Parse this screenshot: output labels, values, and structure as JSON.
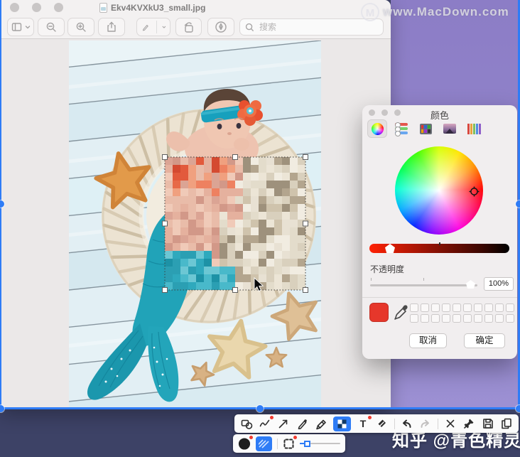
{
  "window": {
    "title": "Ekv4KVXkU3_small.jpg",
    "traffic_lights": [
      "close",
      "minimize",
      "zoom"
    ],
    "toolbar": {
      "icons": [
        "sidebar",
        "zoom-out",
        "zoom-in",
        "share",
        "markup-pen",
        "rotate-left",
        "markup-toggle",
        "search"
      ],
      "search_placeholder": "搜索"
    }
  },
  "watermarks": {
    "macdown_logo": "M",
    "macdown": "www.MacDown.com",
    "zhihu": "知乎 @青色精灵"
  },
  "color_panel": {
    "title": "颜色",
    "tabs": [
      "color-wheel",
      "color-sliders",
      "color-palettes",
      "image-palettes",
      "pencils"
    ],
    "selected_tab": "color-wheel",
    "opacity_label": "不透明度",
    "opacity_value": "100%",
    "cancel_label": "取消",
    "confirm_label": "确定",
    "selected_color": "#e6372b",
    "empty_swatch_count": 20
  },
  "annotation_toolbar": {
    "row1_tools": [
      "shapes",
      "scribble",
      "arrow",
      "pencil",
      "highlighter",
      "mosaic",
      "text",
      "eraser",
      "undo",
      "redo",
      "close",
      "pin",
      "save",
      "copy"
    ],
    "active_tool": "mosaic",
    "badged_tools": [
      "scribble",
      "text",
      "color-swatch",
      "border-style"
    ],
    "row2_tools": [
      "color-black",
      "fill-style",
      "border-style",
      "line-width-slider"
    ]
  },
  "colors": {
    "accent_blue": "#2e7cf6",
    "desktop_purple": "#8c7dc6",
    "dock_navy": "#3d4266",
    "swatch_red": "#e6372b"
  },
  "photo": {
    "subject": "baby-mermaid-on-rope-coil",
    "mosaic_palette": {
      "teal": [
        "#2fa9bd",
        "#49b9ca",
        "#1d92a6",
        "#6cc7d4",
        "#2b9fb3"
      ],
      "skin": [
        "#e9bca9",
        "#dba494",
        "#f0cab8",
        "#d29888",
        "#e5b19e"
      ],
      "flower": [
        "#e25a3c",
        "#ee8160",
        "#d44a31",
        "#f0a07f",
        "#e76a48"
      ],
      "rope": [
        "#e8e1d3",
        "#d9d0bd",
        "#f1ece1",
        "#e3dccb",
        "#cfc3ac",
        "#b3a58e",
        "#9e917c",
        "#ece5d6"
      ]
    }
  }
}
